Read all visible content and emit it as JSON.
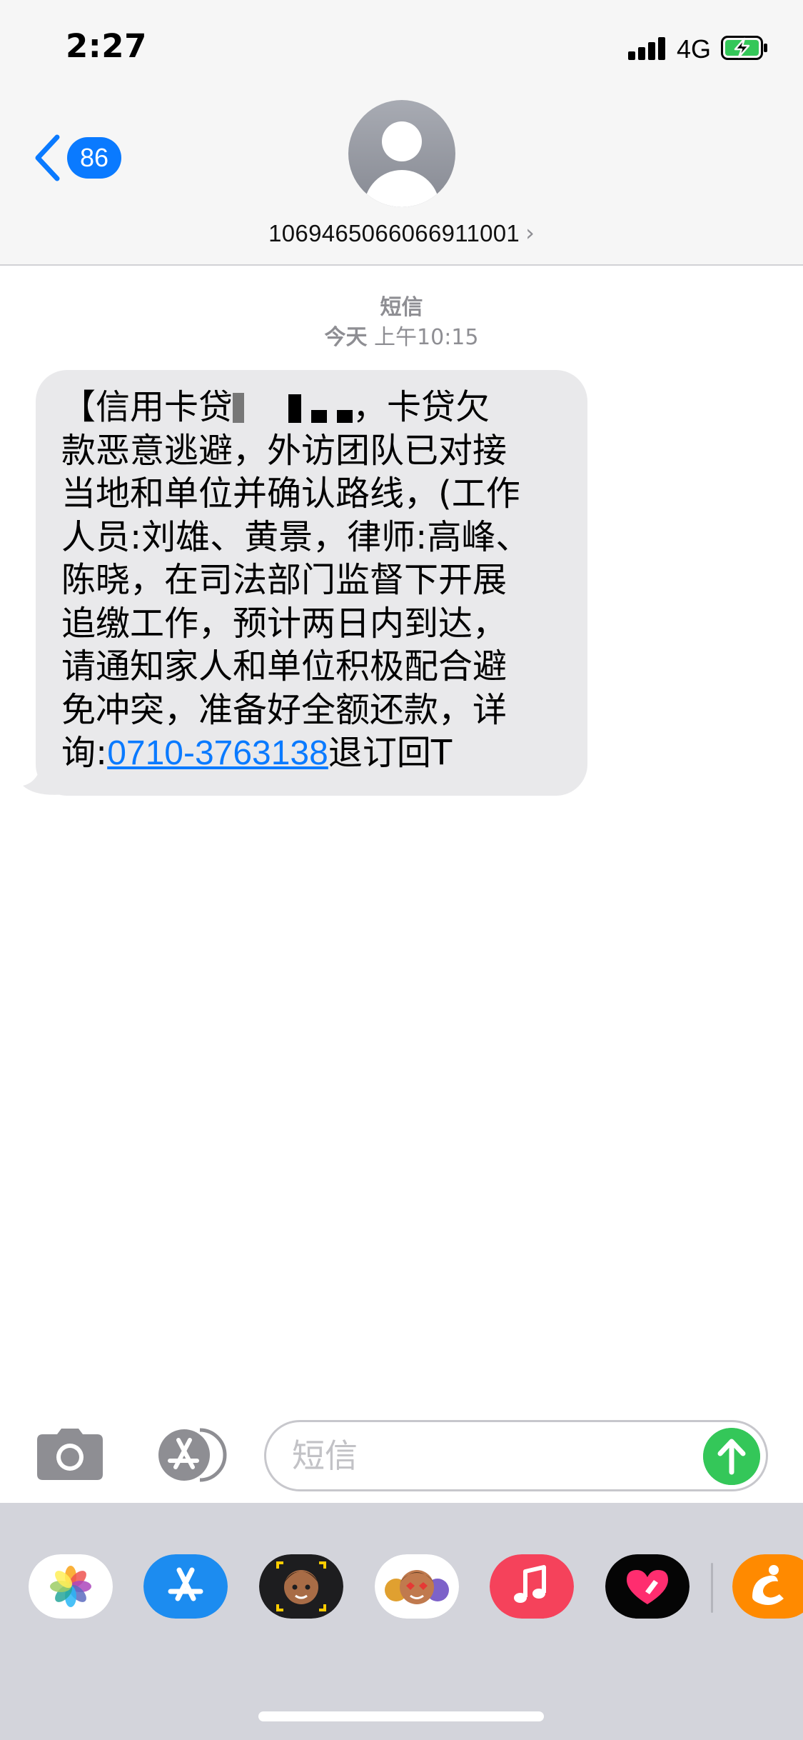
{
  "status_bar": {
    "time": "2:27",
    "network": "4G",
    "signal_bars": 4,
    "battery_state": "charging",
    "battery_color": "#34c759"
  },
  "header": {
    "back_badge_count": "86",
    "contact_number": "1069465066066911001",
    "avatar_icon": "person-silhouette-icon",
    "detail_icon": "chevron-right-icon"
  },
  "conversation": {
    "service_label": "短信",
    "timestamp_day": "今天",
    "timestamp_time": "上午10:15",
    "message": {
      "line1_start": "【信用卡贷",
      "line1_end": "，卡贷欠",
      "line2": "款恶意逃避，外访团队已对接",
      "line3": "当地和单位并确认路线，(工作",
      "line4": "人员:刘雄、黄景，律师:高峰、",
      "line5": "陈晓，在司法部门监督下开展",
      "line6": "追缴工作，预计两日内到达，",
      "line7": "请通知家人和单位积极配合避",
      "line8": "免冲突，准备好全额还款，详",
      "line9_prefix": "询:",
      "phone_link": "0710-3763138",
      "line9_suffix": "退订回T"
    }
  },
  "input_bar": {
    "placeholder": "短信",
    "camera_icon": "camera-icon",
    "apps_icon": "app-store-icon",
    "send_icon": "arrow-up-icon",
    "send_color": "#34c759"
  },
  "app_drawer": {
    "apps": [
      {
        "icon": "photos-icon"
      },
      {
        "icon": "app-store-icon"
      },
      {
        "icon": "memoji-camera-icon"
      },
      {
        "icon": "memoji-stickers-icon"
      },
      {
        "icon": "music-icon"
      },
      {
        "icon": "digital-touch-icon"
      },
      {
        "icon": "uc-browser-icon"
      }
    ]
  },
  "colors": {
    "accent_blue": "#0a7aff",
    "bubble_gray": "#e9e9eb",
    "meta_gray": "#8e8e93",
    "header_bg": "#f6f6f6",
    "drawer_bg": "#d3d4db"
  }
}
